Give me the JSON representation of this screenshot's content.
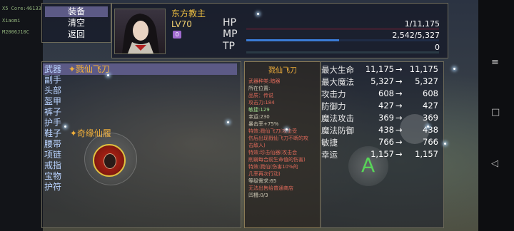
{
  "system": {
    "line1": "X5 Core:46133",
    "line2": "Xiaomi",
    "line3": "M2006J10C"
  },
  "menu": {
    "items": [
      {
        "label": "装备"
      },
      {
        "label": "清空"
      },
      {
        "label": "返回"
      }
    ]
  },
  "character": {
    "name": "东方教主",
    "level": "LV70",
    "badge": "0"
  },
  "stats": [
    {
      "label": "HP",
      "value": "1/11,175",
      "fill": 0.0001,
      "color": "#d33"
    },
    {
      "label": "MP",
      "value": "2,542/5,327",
      "fill": 0.48,
      "color": "#3a7bd5"
    },
    {
      "label": "TP",
      "value": "0",
      "fill": 0,
      "color": "#7ad"
    }
  ],
  "equipment": {
    "slots": [
      {
        "slot": "武器",
        "item": "戮仙飞刀"
      },
      {
        "slot": "副手",
        "item": ""
      },
      {
        "slot": "头部",
        "item": ""
      },
      {
        "slot": "盔甲",
        "item": ""
      },
      {
        "slot": "裤子",
        "item": ""
      },
      {
        "slot": "护手",
        "item": ""
      },
      {
        "slot": "鞋子",
        "item": "奇缘仙履"
      },
      {
        "slot": "腰带",
        "item": ""
      },
      {
        "slot": "项链",
        "item": ""
      },
      {
        "slot": "戒指",
        "item": ""
      },
      {
        "slot": "宝物",
        "item": ""
      },
      {
        "slot": "护符",
        "item": ""
      }
    ]
  },
  "tooltip": {
    "title": "戮仙飞刀",
    "lines": [
      {
        "text": "武器种类:暗器",
        "cls": "r"
      },
      {
        "text": "所在位置:",
        "cls": ""
      },
      {
        "text": "品质：传说",
        "cls": "r"
      },
      {
        "text": "攻击力:184",
        "cls": "r"
      },
      {
        "text": "敏捷:129",
        "cls": "g"
      },
      {
        "text": "幸运:230",
        "cls": ""
      },
      {
        "text": "暴击率+75%",
        "cls": ""
      },
      {
        "text": "特效:戮仙飞刀(攻击受",
        "cls": "r"
      },
      {
        "text": "伤后出现戮仙飞刀不断的攻",
        "cls": "r"
      },
      {
        "text": "击敌人)",
        "cls": "r"
      },
      {
        "text": "特效:珍击仙器(攻击会",
        "cls": "r"
      },
      {
        "text": "削弱每合前生命值的伤害)",
        "cls": "r"
      },
      {
        "text": "特效:戮仙(伤害10%的",
        "cls": "r"
      },
      {
        "text": "几率再次行动)",
        "cls": "r"
      },
      {
        "text": "等级需求:65",
        "cls": ""
      },
      {
        "text": "无法出售给普通商店",
        "cls": "r"
      },
      {
        "text": "凹槽:0/3",
        "cls": ""
      }
    ]
  },
  "compare": [
    {
      "label": "最大生命",
      "v1": "11,175",
      "v2": "11,175"
    },
    {
      "label": "最大魔法",
      "v1": "5,327",
      "v2": "5,327"
    },
    {
      "label": "攻击力",
      "v1": "608",
      "v2": "608"
    },
    {
      "label": "防御力",
      "v1": "427",
      "v2": "427"
    },
    {
      "label": "魔法攻击",
      "v1": "369",
      "v2": "369"
    },
    {
      "label": "魔法防御",
      "v1": "438",
      "v2": "438"
    },
    {
      "label": "敏捷",
      "v1": "766",
      "v2": "766"
    },
    {
      "label": "幸运",
      "v1": "1,157",
      "v2": "1,157"
    }
  ],
  "arrow": "→",
  "buttons": {
    "action": "A"
  }
}
